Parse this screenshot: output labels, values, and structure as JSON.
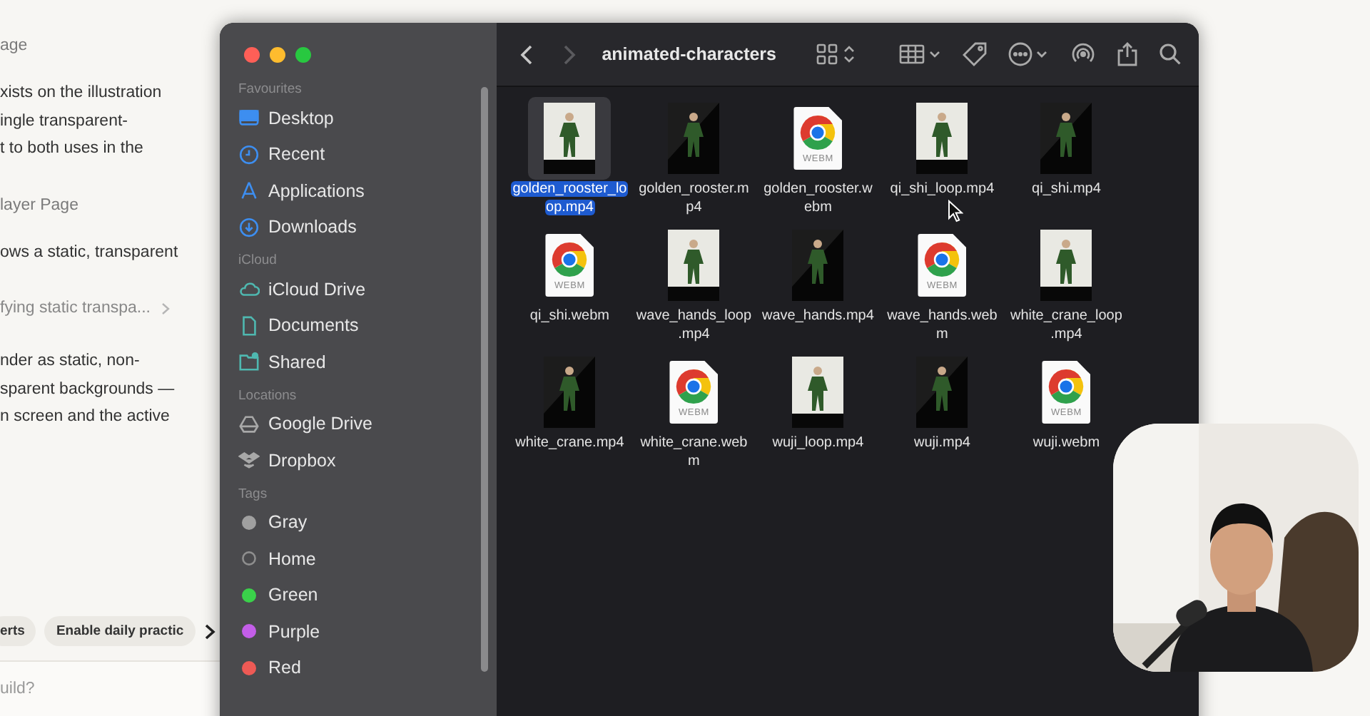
{
  "page": {
    "blocks": [
      {
        "kind": "heading",
        "text": "age"
      },
      {
        "kind": "body",
        "lines": [
          "xists on the illustration",
          "ingle transparent-",
          "t to both uses in the"
        ]
      },
      {
        "kind": "heading",
        "text": "layer Page"
      },
      {
        "kind": "body",
        "lines": [
          "ows a static, transparent"
        ]
      },
      {
        "kind": "link",
        "text": "fying static transpa..."
      },
      {
        "kind": "body",
        "lines": [
          "nder as static, non-",
          "sparent backgrounds —",
          "n screen and the active"
        ]
      }
    ],
    "chips": [
      "erts",
      "Enable daily practic"
    ],
    "composer": {
      "placeholder": "uild?"
    }
  },
  "finder": {
    "title": "animated-characters",
    "sidebar": [
      {
        "header": "Favourites",
        "items": [
          {
            "label": "Desktop",
            "kind": "desktop"
          },
          {
            "label": "Recent",
            "kind": "clock"
          },
          {
            "label": "Applications",
            "kind": "apps"
          },
          {
            "label": "Downloads",
            "kind": "download"
          }
        ]
      },
      {
        "header": "iCloud",
        "items": [
          {
            "label": "iCloud Drive",
            "kind": "cloud"
          },
          {
            "label": "Documents",
            "kind": "doc"
          },
          {
            "label": "Shared",
            "kind": "shared"
          }
        ]
      },
      {
        "header": "Locations",
        "items": [
          {
            "label": "Google Drive",
            "kind": "drive"
          },
          {
            "label": "Dropbox",
            "kind": "dropbox"
          }
        ]
      }
    ],
    "tags": {
      "header": "Tags",
      "items": [
        {
          "label": "Gray",
          "kind": "dot",
          "color": "#a0a0a0"
        },
        {
          "label": "Home",
          "kind": "ring",
          "color": "#8e8e8e"
        },
        {
          "label": "Green",
          "kind": "dot",
          "color": "#3ad14a"
        },
        {
          "label": "Purple",
          "kind": "dot",
          "color": "#c35ee8"
        },
        {
          "label": "Red",
          "kind": "dot",
          "color": "#ee5a55"
        }
      ]
    },
    "files": [
      {
        "lines": [
          "golden_rooster_lo",
          "op.mp4"
        ],
        "kind": "light",
        "selected": true
      },
      {
        "lines": [
          "golden_rooster.m",
          "p4"
        ],
        "kind": "dark",
        "selected": false
      },
      {
        "lines": [
          "golden_rooster.w",
          "ebm"
        ],
        "kind": "webm",
        "badge": "WEBM",
        "selected": false
      },
      {
        "lines": [
          "qi_shi_loop.mp4"
        ],
        "kind": "light",
        "selected": false
      },
      {
        "lines": [
          "qi_shi.mp4"
        ],
        "kind": "dark",
        "selected": false
      },
      {
        "lines": [
          "qi_shi.webm"
        ],
        "kind": "webm",
        "badge": "WEBM",
        "selected": false
      },
      {
        "lines": [
          "wave_hands_loop",
          ".mp4"
        ],
        "kind": "light",
        "selected": false
      },
      {
        "lines": [
          "wave_hands.mp4"
        ],
        "kind": "dark",
        "selected": false
      },
      {
        "lines": [
          "wave_hands.web",
          "m"
        ],
        "kind": "webm",
        "badge": "WEBM",
        "selected": false
      },
      {
        "lines": [
          "white_crane_loop",
          ".mp4"
        ],
        "kind": "light",
        "selected": false
      },
      {
        "lines": [
          "white_crane.mp4"
        ],
        "kind": "dark",
        "selected": false
      },
      {
        "lines": [
          "white_crane.web",
          "m"
        ],
        "kind": "webm",
        "badge": "WEBM",
        "selected": false
      },
      {
        "lines": [
          "wuji_loop.mp4"
        ],
        "kind": "light",
        "selected": false
      },
      {
        "lines": [
          "wuji.mp4"
        ],
        "kind": "dark",
        "selected": false
      },
      {
        "lines": [
          "wuji.webm"
        ],
        "kind": "webm",
        "badge": "WEBM",
        "selected": false
      }
    ]
  }
}
